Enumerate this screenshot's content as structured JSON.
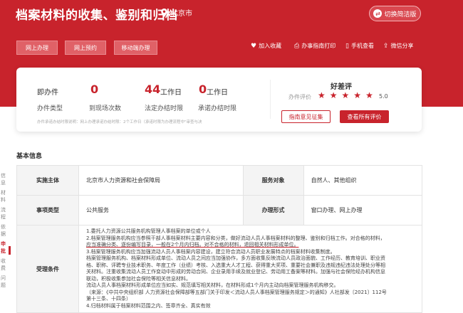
{
  "header": {
    "title": "档案材料的收集、鉴别和归档",
    "location": "北京市",
    "switch_label": "切换简洁版",
    "actions": [
      "网上办理",
      "网上预约",
      "移动端办理"
    ],
    "tools": [
      {
        "icon": "heart-icon",
        "label": "加入收藏"
      },
      {
        "icon": "printer-icon",
        "label": "办事指南打印"
      },
      {
        "icon": "phone-icon",
        "label": "手机查看"
      },
      {
        "icon": "share-icon",
        "label": "微信分享"
      }
    ]
  },
  "stats": {
    "instant_label": "即办件",
    "type_label": "办件类型",
    "visits_value": "0",
    "visits_label": "到现场次数",
    "legal_value": "44",
    "legal_unit": "工作日",
    "legal_label": "法定办结时限",
    "promise_value": "0",
    "promise_unit": "工作日",
    "promise_label": "承诺办结时限",
    "note": "办件承诺办结时限说明：网上办理承诺办结时限：2个工作日（承诺时限为办理流程中\"审查与决"
  },
  "rating": {
    "title": "好差评",
    "label": "办件评价",
    "stars": 5,
    "score": "5.0",
    "opinion_button": "指南意见征集",
    "all_button": "查看所有评价"
  },
  "side_nav": [
    "信息",
    "材料",
    "流程",
    "依据",
    "申批",
    "收费",
    "问题"
  ],
  "basic_info": {
    "section_title": "基本信息",
    "rows": [
      {
        "k1": "实施主体",
        "v1": "北京市人力资源和社会保障局",
        "k2": "服务对象",
        "v2": "自然人、其他组织"
      },
      {
        "k1": "事项类型",
        "v1": "公共服务",
        "k2": "办理形式",
        "v2": "窗口办理、网上办理"
      }
    ],
    "conditions_label": "受理条件",
    "conditions": [
      "1.委托人力资源公共服务机构管理人事档案的单位或个人",
      "2.档案管理服务机构应当参照干部人事档案材料主要内容和分类，做好流动人员人事档案材料的整理、鉴别和归档工作。对合格的材料，",
      "应当准确分类、逐份编写目录，一般在2个月内归档。对不合格的材料，退回相关材料形成单位。",
      "3.档案管理服务机构应当加强流动人员人事档案内容建设，建立符合流动人员职业发展特点的档案材料收集制度。",
      "档案管理服务机构、档案材料形成单位、流动人员之间应当加强协作，多方面收集反映流动人员政治面貌、工作经历、教育培训、职业资",
      "格、职称、评聘专业技术职务、年度工作（业绩）考核、入选重大人才工程、获得重大奖项、重要社会兼职及违规违纪违法处理处分等相",
      "关材料。注重收集流动人员工作变动中形成的劳动合同、企业录用手续及就业登记、劳动用工备案等材料。加强与社会保险经办机构信息",
      "联动，积极收集参加社会保险等相关信息材料。",
      "流动人员人事档案材料形成单位应当如实、规范填写相关材料，在材料形成1个月内主动向档案管理服务机构移交。",
      "（来源：《中共中央组织部 人力资源社会保障部等五部门关于印发＜流动人员人事档案管理服务规定＞的通知》人社部发〔2021〕112号",
      "第十三条、十四条）",
      "4.归档材料属于档案材料范围之内、签章齐全、真实有效"
    ]
  },
  "colors": {
    "brand": "#c8232c",
    "muted": "#999999"
  }
}
